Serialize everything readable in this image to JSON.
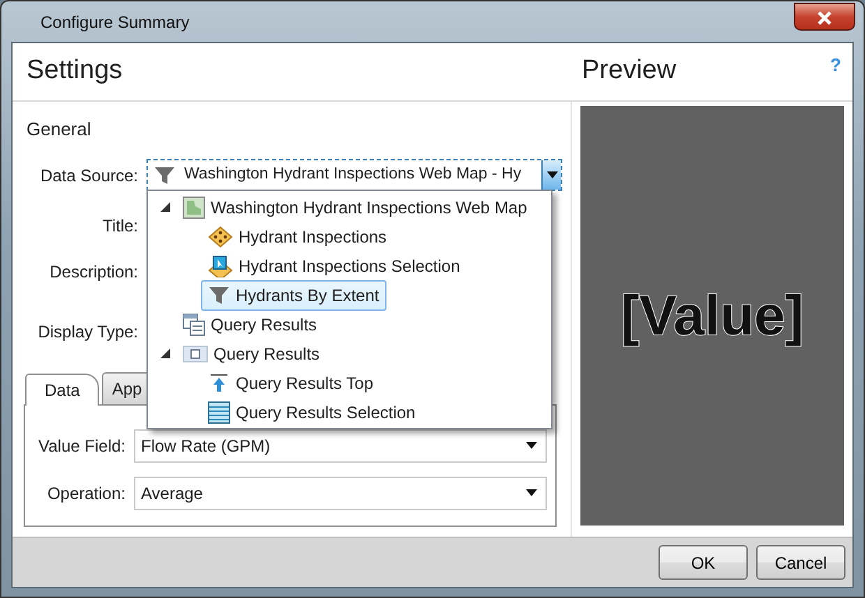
{
  "window": {
    "title": "Configure Summary"
  },
  "header": {
    "settings_title": "Settings",
    "preview_title": "Preview",
    "help": "?"
  },
  "general": {
    "heading": "General",
    "labels": [
      "Data Source:",
      "Title:",
      "Description:",
      "Display Type:"
    ],
    "data_source": {
      "value": "Washington Hydrant Inspections Web Map - Hy",
      "expanded": true
    }
  },
  "dropdown": {
    "items": [
      {
        "label": "Washington Hydrant Inspections Web Map",
        "kind": "map",
        "expanded": true,
        "selected": false,
        "children": [
          {
            "label": "Hydrant Inspections",
            "kind": "layer",
            "selected": false
          },
          {
            "label": "Hydrant Inspections Selection",
            "kind": "selection",
            "selected": false
          },
          {
            "label": "Hydrants By Extent",
            "kind": "filter",
            "selected": true
          }
        ]
      },
      {
        "label": "Query Results",
        "kind": "table",
        "selected": false
      },
      {
        "label": "Query Results",
        "kind": "query",
        "expanded": true,
        "selected": false,
        "children": [
          {
            "label": "Query Results Top",
            "kind": "top",
            "selected": false
          },
          {
            "label": "Query Results Selection",
            "kind": "rows",
            "selected": false
          }
        ]
      }
    ]
  },
  "tabs": [
    {
      "label": "Data",
      "selected": true
    },
    {
      "label": "App",
      "selected": false
    }
  ],
  "data_fields": [
    {
      "label": "Value Field:",
      "value": "Flow Rate (GPM)"
    },
    {
      "label": "Operation:",
      "value": "Average"
    }
  ],
  "preview": {
    "value": "[Value]"
  },
  "buttons": [
    "OK",
    "Cancel"
  ]
}
